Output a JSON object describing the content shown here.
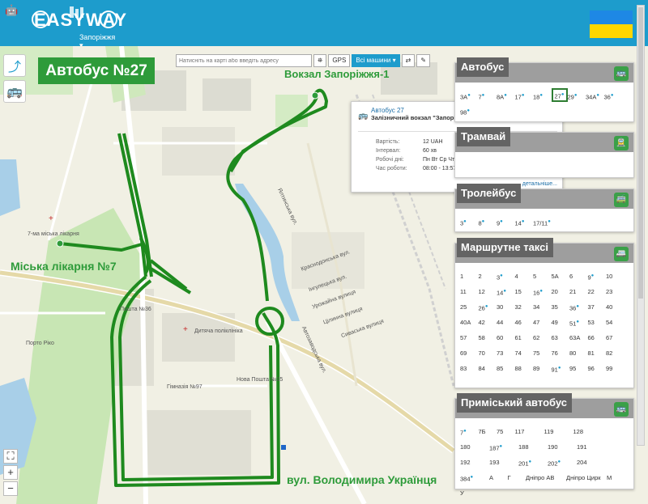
{
  "app": {
    "logo_text": "EASYWAY",
    "city": "Запоріжжя ▾",
    "android_icon": "android-icon",
    "apple_icon": "apple-icon"
  },
  "map": {
    "route_title": "Автобус №27",
    "search_placeholder": "Натисніть на карті або введіть адресу",
    "gps_label": "GPS",
    "vehicles_label": "Всі машини ▾",
    "labels": {
      "station": "Вокзал Запоріжжя-1",
      "hospital": "Міська лікарня №7",
      "street": "вул. Володимира Українця"
    },
    "zoom_in": "+",
    "zoom_out": "−",
    "fullscreen": "⛶",
    "streets": [
      {
        "text": "7-ма міська лікарня",
        "x": 0,
        "y": 0
      },
      {
        "text": "Пошта №36"
      },
      {
        "text": "Дитяча поліклініка"
      },
      {
        "text": "Нова Пошта №15"
      },
      {
        "text": "Гімназія №97"
      },
      {
        "text": "Вулиця Карпенка-Карого"
      },
      {
        "text": "Автозаводська вул."
      },
      {
        "text": "Сиваська вулиця"
      },
      {
        "text": "Краснодонська вул."
      },
      {
        "text": "Інгулецька вул."
      },
      {
        "text": "Урожайна вулиця"
      },
      {
        "text": "Цілинна вулиця"
      },
      {
        "text": "Ялтинська вул."
      },
      {
        "text": "Порто Ріко"
      },
      {
        "text": "Пошта №36"
      }
    ]
  },
  "popup": {
    "title": "Автобус 27",
    "subtitle": "Залізничний вокзал \"Запоріжжя-1\" - 7-а міськлікарня",
    "rows": [
      {
        "k": "Вартість:",
        "v": "12 UAH"
      },
      {
        "k": "Інтервал:",
        "v": "60 хв"
      },
      {
        "k": "Робочі дні:",
        "v": "Пн Вт Ср Чт Пт"
      },
      {
        "k": "Час роботи:",
        "v": "08:00 - 13:57"
      }
    ],
    "more": "детальніше..."
  },
  "panels": {
    "bus": {
      "title": "Автобус",
      "routes": [
        "3А",
        "7",
        "8А",
        "17",
        "18",
        "27",
        "29",
        "34А",
        "36",
        "98"
      ]
    },
    "tram": {
      "title": "Трамвай",
      "routes": []
    },
    "trolley": {
      "title": "Тролейбус",
      "routes": [
        "3",
        "8",
        "9",
        "14",
        "17/11"
      ]
    },
    "minibus": {
      "title": "Маршрутне таксі",
      "routes": [
        "1",
        "2",
        "3",
        "4",
        "5",
        "5А",
        "6",
        "9",
        "10",
        "11",
        "12",
        "14",
        "15",
        "16",
        "20",
        "21",
        "22",
        "23",
        "25",
        "26",
        "30",
        "32",
        "34",
        "35",
        "36",
        "37",
        "40",
        "40А",
        "42",
        "44",
        "46",
        "47",
        "49",
        "51",
        "53",
        "54",
        "57",
        "58",
        "60",
        "61",
        "62",
        "63",
        "63А",
        "66",
        "67",
        "69",
        "70",
        "73",
        "74",
        "75",
        "76",
        "80",
        "81",
        "82",
        "83",
        "84",
        "85",
        "88",
        "89",
        "91",
        "95",
        "96",
        "99"
      ]
    },
    "suburban": {
      "title": "Приміський автобус",
      "routes": [
        "7",
        "7Б",
        "75",
        "117",
        "119",
        "128",
        "180",
        "187",
        "188",
        "190",
        "191",
        "192",
        "193",
        "201",
        "202",
        "204",
        "384",
        "А",
        "Г",
        "Дніпро АВ",
        "Дніпро Цирк",
        "М",
        "У"
      ]
    }
  },
  "colors": {
    "header": "#1d9ccc",
    "route": "#1e8a1e",
    "accent_green": "#2e9b3a"
  }
}
